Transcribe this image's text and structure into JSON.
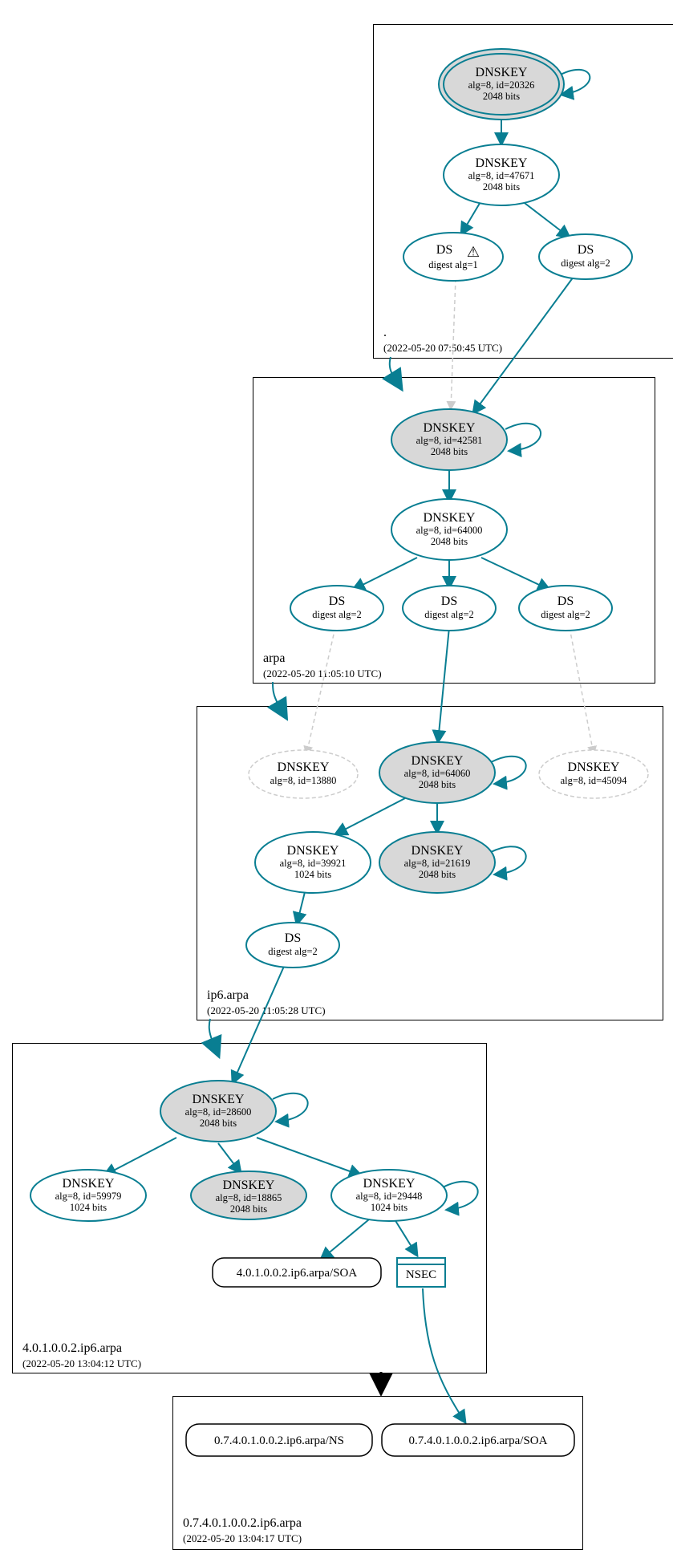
{
  "zones": {
    "root": {
      "name": ".",
      "timestamp": "(2022-05-20 07:50:45 UTC)",
      "dnskey1": {
        "title": "DNSKEY",
        "line1": "alg=8, id=20326",
        "line2": "2048 bits"
      },
      "dnskey2": {
        "title": "DNSKEY",
        "line1": "alg=8, id=47671",
        "line2": "2048 bits"
      },
      "ds1": {
        "title": "DS",
        "sub": "digest alg=1",
        "warn": "⚠"
      },
      "ds2": {
        "title": "DS",
        "sub": "digest alg=2"
      }
    },
    "arpa": {
      "name": "arpa",
      "timestamp": "(2022-05-20 11:05:10 UTC)",
      "dnskey1": {
        "title": "DNSKEY",
        "line1": "alg=8, id=42581",
        "line2": "2048 bits"
      },
      "dnskey2": {
        "title": "DNSKEY",
        "line1": "alg=8, id=64000",
        "line2": "2048 bits"
      },
      "ds1": {
        "title": "DS",
        "sub": "digest alg=2"
      },
      "ds2": {
        "title": "DS",
        "sub": "digest alg=2"
      },
      "ds3": {
        "title": "DS",
        "sub": "digest alg=2"
      }
    },
    "ip6": {
      "name": "ip6.arpa",
      "timestamp": "(2022-05-20 11:05:28 UTC)",
      "dnskey_dashed1": {
        "title": "DNSKEY",
        "line1": "alg=8, id=13880"
      },
      "dnskey1": {
        "title": "DNSKEY",
        "line1": "alg=8, id=64060",
        "line2": "2048 bits"
      },
      "dnskey_dashed2": {
        "title": "DNSKEY",
        "line1": "alg=8, id=45094"
      },
      "dnskey2": {
        "title": "DNSKEY",
        "line1": "alg=8, id=39921",
        "line2": "1024 bits"
      },
      "dnskey3": {
        "title": "DNSKEY",
        "line1": "alg=8, id=21619",
        "line2": "2048 bits"
      },
      "ds1": {
        "title": "DS",
        "sub": "digest alg=2"
      }
    },
    "z40": {
      "name": "4.0.1.0.0.2.ip6.arpa",
      "timestamp": "(2022-05-20 13:04:12 UTC)",
      "dnskey1": {
        "title": "DNSKEY",
        "line1": "alg=8, id=28600",
        "line2": "2048 bits"
      },
      "dnskey2": {
        "title": "DNSKEY",
        "line1": "alg=8, id=59979",
        "line2": "1024 bits"
      },
      "dnskey3": {
        "title": "DNSKEY",
        "line1": "alg=8, id=18865",
        "line2": "2048 bits"
      },
      "dnskey4": {
        "title": "DNSKEY",
        "line1": "alg=8, id=29448",
        "line2": "1024 bits"
      },
      "soa": "4.0.1.0.0.2.ip6.arpa/SOA",
      "nsec": "NSEC"
    },
    "z07": {
      "name": "0.7.4.0.1.0.0.2.ip6.arpa",
      "timestamp": "(2022-05-20 13:04:17 UTC)",
      "rr1": "0.7.4.0.1.0.0.2.ip6.arpa/NS",
      "rr2": "0.7.4.0.1.0.0.2.ip6.arpa/SOA"
    }
  }
}
